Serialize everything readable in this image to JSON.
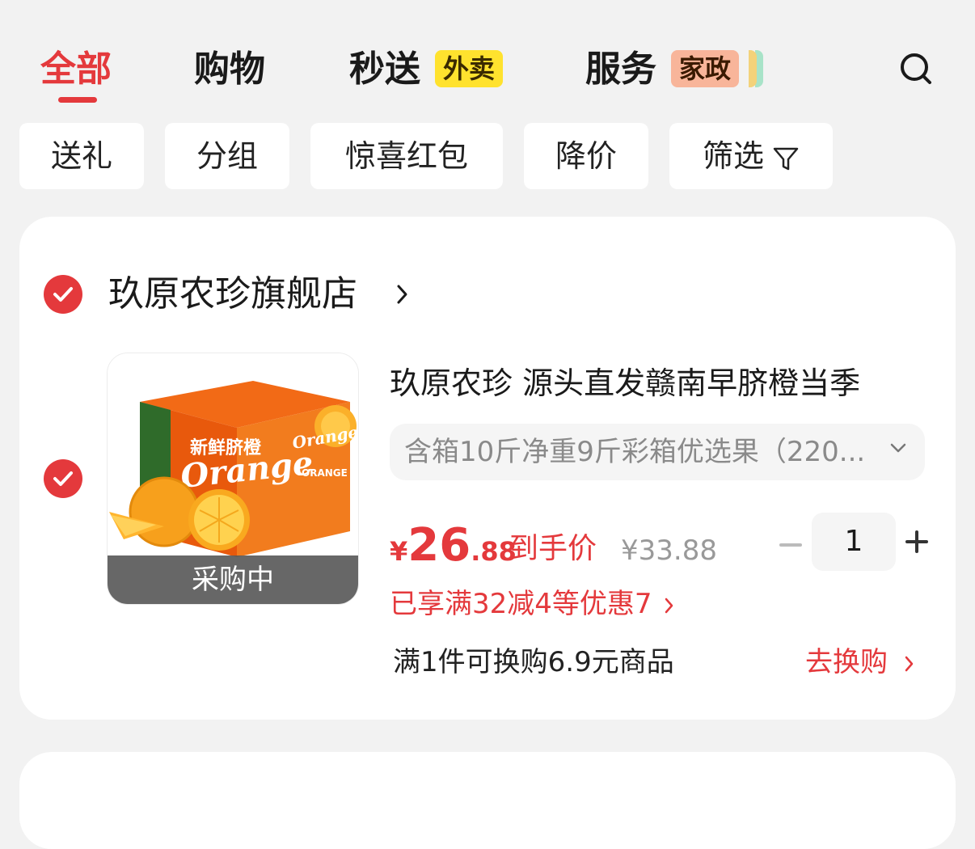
{
  "tabs": [
    {
      "label": "全部",
      "active": true
    },
    {
      "label": "购物"
    },
    {
      "label": "秒送",
      "tag": "外卖"
    },
    {
      "label": "服务",
      "tag": "家政"
    }
  ],
  "filters": [
    "送礼",
    "分组",
    "惊喜红包",
    "降价",
    "筛选"
  ],
  "shop": {
    "name": "玖原农珍旗舰店",
    "checked": true
  },
  "product": {
    "checked": true,
    "image_label": "采购中",
    "title": "玖原农珍 源头直发赣南早脐橙当季",
    "spec": "含箱10斤净重9斤彩箱优选果（220...",
    "price_currency": "¥",
    "price_int": "26",
    "price_dec": ".88",
    "price_note": "到手价",
    "original_price": "¥33.88",
    "quantity": "1",
    "promo": "已享满32减4等优惠7",
    "exchange": "满1件可换购6.9元商品",
    "exchange_link": "去换购",
    "box_text": {
      "cn": "新鲜脐橙",
      "en": "Orange",
      "en_upper": "ORANGE"
    }
  },
  "colors": {
    "accent": "#e4393c",
    "background": "#f2f2f2",
    "tag_yellow": "#ffe22e",
    "tag_peach": "#f8b59a"
  },
  "icons": [
    "search-icon",
    "filter-icon",
    "check-icon",
    "chevron-right-icon",
    "chevron-down-icon",
    "minus-icon",
    "plus-icon"
  ]
}
